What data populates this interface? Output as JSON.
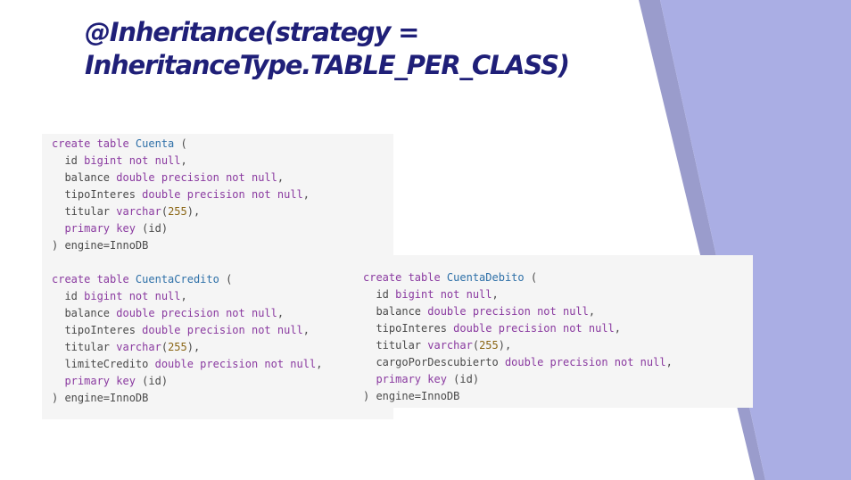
{
  "slide": {
    "title_line1": "@Inheritance(strategy =",
    "title_line2": "InheritanceType.TABLE_PER_CLASS)",
    "colors": {
      "title": "#1f1f78",
      "accent_light": "#aaaee4",
      "accent_dark": "#9a9ccc",
      "code_bg": "#f5f5f5",
      "keyword": "#8a3aa0",
      "identifier": "#2e70a8",
      "number": "#8a6514"
    }
  },
  "code_blocks": [
    {
      "name": "Cuenta",
      "lines": [
        [
          [
            "kw",
            "create table "
          ],
          [
            "nm",
            "Cuenta"
          ],
          [
            "pl",
            " ("
          ]
        ],
        [
          [
            "pl",
            "  id "
          ],
          [
            "kw",
            "bigint not null"
          ],
          [
            "pl",
            ","
          ]
        ],
        [
          [
            "pl",
            "  balance "
          ],
          [
            "kw",
            "double precision not null"
          ],
          [
            "pl",
            ","
          ]
        ],
        [
          [
            "pl",
            "  tipoInteres "
          ],
          [
            "kw",
            "double precision not null"
          ],
          [
            "pl",
            ","
          ]
        ],
        [
          [
            "pl",
            "  titular "
          ],
          [
            "kw",
            "varchar"
          ],
          [
            "pl",
            "("
          ],
          [
            "num",
            "255"
          ],
          [
            "pl",
            "),"
          ]
        ],
        [
          [
            "kw",
            "  primary key"
          ],
          [
            "pl",
            " (id)"
          ]
        ],
        [
          [
            "pl",
            ") engine=InnoDB"
          ]
        ]
      ]
    },
    {
      "name": "CuentaCredito",
      "lines": [
        [
          [
            "kw",
            "create table "
          ],
          [
            "nm",
            "CuentaCredito"
          ],
          [
            "pl",
            " ("
          ]
        ],
        [
          [
            "pl",
            "  id "
          ],
          [
            "kw",
            "bigint not null"
          ],
          [
            "pl",
            ","
          ]
        ],
        [
          [
            "pl",
            "  balance "
          ],
          [
            "kw",
            "double precision not null"
          ],
          [
            "pl",
            ","
          ]
        ],
        [
          [
            "pl",
            "  tipoInteres "
          ],
          [
            "kw",
            "double precision not null"
          ],
          [
            "pl",
            ","
          ]
        ],
        [
          [
            "pl",
            "  titular "
          ],
          [
            "kw",
            "varchar"
          ],
          [
            "pl",
            "("
          ],
          [
            "num",
            "255"
          ],
          [
            "pl",
            "),"
          ]
        ],
        [
          [
            "pl",
            "  limiteCredito "
          ],
          [
            "kw",
            "double precision not null"
          ],
          [
            "pl",
            ","
          ]
        ],
        [
          [
            "kw",
            "  primary key"
          ],
          [
            "pl",
            " (id)"
          ]
        ],
        [
          [
            "pl",
            ") engine=InnoDB"
          ]
        ]
      ]
    },
    {
      "name": "CuentaDebito",
      "lines": [
        [
          [
            "kw",
            "create table "
          ],
          [
            "nm",
            "CuentaDebito"
          ],
          [
            "pl",
            " ("
          ]
        ],
        [
          [
            "pl",
            "  id "
          ],
          [
            "kw",
            "bigint not null"
          ],
          [
            "pl",
            ","
          ]
        ],
        [
          [
            "pl",
            "  balance "
          ],
          [
            "kw",
            "double precision not null"
          ],
          [
            "pl",
            ","
          ]
        ],
        [
          [
            "pl",
            "  tipoInteres "
          ],
          [
            "kw",
            "double precision not null"
          ],
          [
            "pl",
            ","
          ]
        ],
        [
          [
            "pl",
            "  titular "
          ],
          [
            "kw",
            "varchar"
          ],
          [
            "pl",
            "("
          ],
          [
            "num",
            "255"
          ],
          [
            "pl",
            "),"
          ]
        ],
        [
          [
            "pl",
            "  cargoPorDescubierto "
          ],
          [
            "kw",
            "double precision not null"
          ],
          [
            "pl",
            ","
          ]
        ],
        [
          [
            "kw",
            "  primary key"
          ],
          [
            "pl",
            " (id)"
          ]
        ],
        [
          [
            "pl",
            ") engine=InnoDB"
          ]
        ]
      ]
    }
  ]
}
